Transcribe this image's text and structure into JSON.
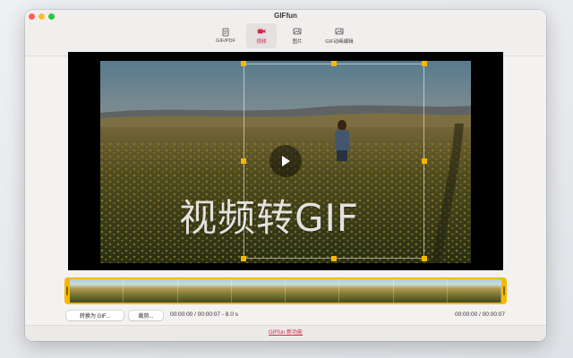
{
  "window": {
    "title": "GIFfun"
  },
  "tabs": [
    {
      "label": "GIF/PDF",
      "icon": "document-icon",
      "active": false
    },
    {
      "label": "视频",
      "icon": "video-camera-icon",
      "active": true
    },
    {
      "label": "图片",
      "icon": "image-icon",
      "active": false
    },
    {
      "label": "GIF动画编辑",
      "icon": "image-edit-icon",
      "active": false
    }
  ],
  "preview": {
    "overlay_text": "视频转GIF"
  },
  "controls": {
    "convert_label": "转换为 GIF...",
    "crop_label": "裁剪...",
    "selection_time": "00:00:00 / 00:00:07 - 8.0 s",
    "playback_time": "00:00:00 / 00:00:07"
  },
  "footer": {
    "link_label": "GIFfun 新功能"
  },
  "colors": {
    "accent": "#d8264a",
    "timeline": "#f5b800",
    "crop_handles": "#f5b800"
  }
}
